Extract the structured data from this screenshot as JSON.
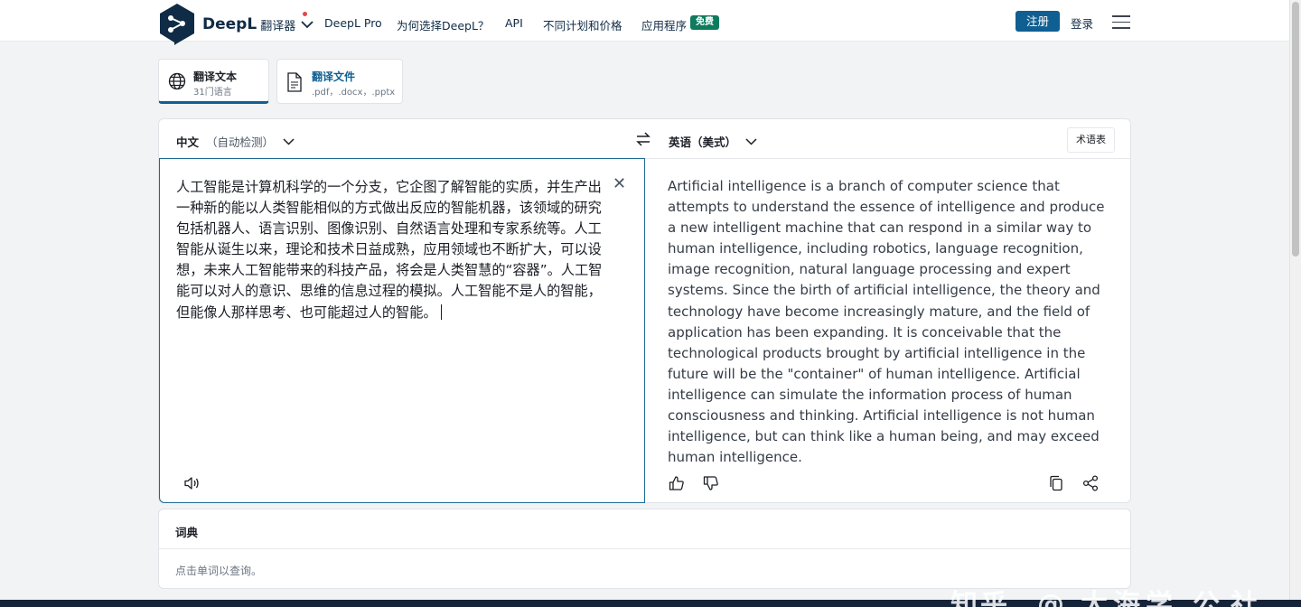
{
  "header": {
    "brand": "DeepL",
    "brand_sub": "翻译器",
    "nav": [
      "DeepL Pro",
      "为何选择DeepL？",
      "API",
      "不同计划和价格",
      "应用程序"
    ],
    "free_badge": "免费",
    "signup": "注册",
    "login": "登录",
    "icons": [
      "deepl-logo-icon",
      "chevron-down-icon",
      "hamburger-menu-icon"
    ]
  },
  "mode_tabs": [
    {
      "title": "翻译文本",
      "subtitle": "31门语言",
      "icon": "globe-icon",
      "active": true
    },
    {
      "title": "翻译文件",
      "subtitle": ".pdf，.docx，.pptx",
      "icon": "document-icon",
      "active": false
    }
  ],
  "translator": {
    "source_lang": "中文",
    "source_lang_note": "（自动检测）",
    "target_lang": "英语（美式）",
    "glossary": "术语表",
    "source_text": "人工智能是计算机科学的一个分支，它企图了解智能的实质，并生产出一种新的能以人类智能相似的方式做出反应的智能机器，该领域的研究包括机器人、语言识别、图像识别、自然语言处理和专家系统等。人工智能从诞生以来，理论和技术日益成熟，应用领域也不断扩大，可以设想，未来人工智能带来的科技产品，将会是人类智慧的“容器”。人工智能可以对人的意识、思维的信息过程的模拟。人工智能不是人的智能，但能像人那样思考、也可能超过人的智能。",
    "target_text": "Artificial intelligence is a branch of computer science that attempts to understand the essence of intelligence and produce a new intelligent machine that can respond in a similar way to human intelligence, including robotics, language recognition, image recognition, natural language processing and expert systems. Since the birth of artificial intelligence, the theory and technology have become increasingly mature, and the field of application has been expanding. It is conceivable that the technological products brought by artificial intelligence in the future will be the \"container\" of human intelligence. Artificial intelligence can simulate the information process of human consciousness and thinking. Artificial intelligence is not human intelligence, but can think like a human being, and may exceed human intelligence.",
    "icons": [
      "swap-icon",
      "clear-icon",
      "speaker-icon",
      "thumbs-up-icon",
      "thumbs-down-icon",
      "copy-icon",
      "share-icon"
    ]
  },
  "dictionary": {
    "title": "词典",
    "hint": "点击单词以查询。"
  },
  "watermark": [
    "知",
    "乎",
    "@",
    "大",
    "海",
    "学",
    "公",
    "社"
  ],
  "colors": {
    "brand": "#0f2b46",
    "accent": "#0f5f92",
    "badge": "#0e7a5e",
    "background": "#f2f3f4"
  }
}
